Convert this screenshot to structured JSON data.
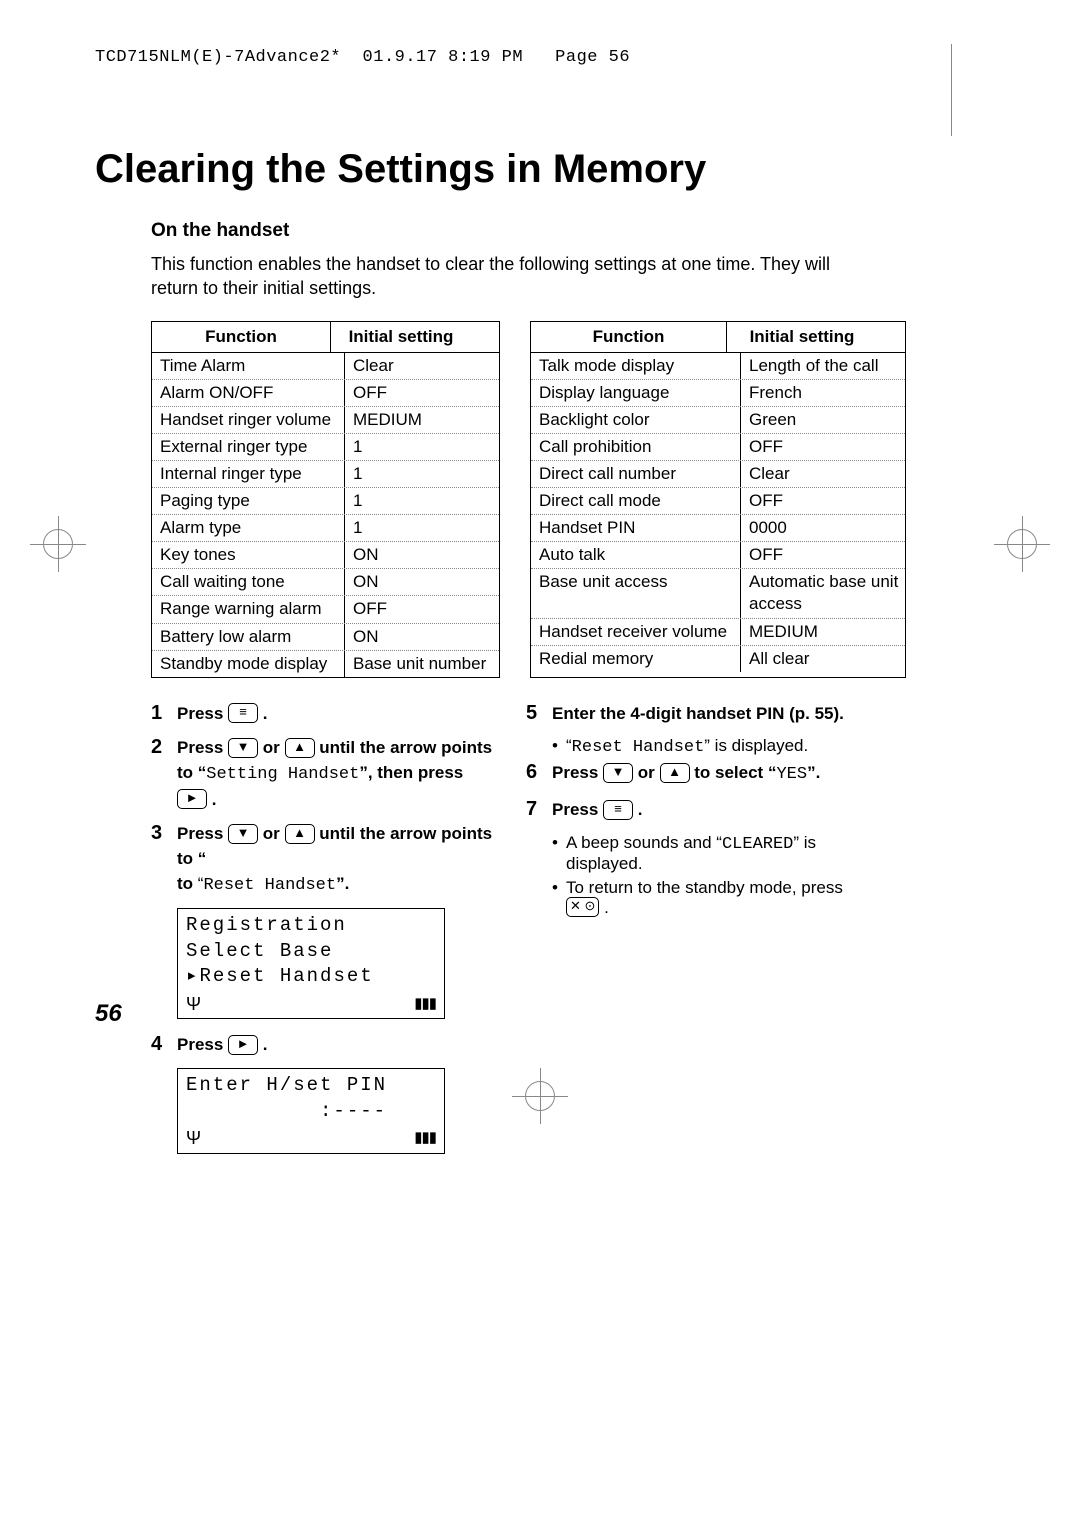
{
  "header_line": "TCD715NLM(E)-7Advance2*  01.9.17 8:19 PM   Page 56",
  "title": "Clearing the Settings in Memory",
  "section": "On the handset",
  "intro": "This function enables the handset to clear the following settings at one time. They will return to their initial settings.",
  "table_headers": {
    "func": "Function",
    "init": "Initial setting"
  },
  "tableA": [
    {
      "f": "Time Alarm",
      "v": "Clear"
    },
    {
      "f": "Alarm ON/OFF",
      "v": "OFF"
    },
    {
      "f": "Handset ringer volume",
      "v": "MEDIUM"
    },
    {
      "f": "External ringer type",
      "v": "1"
    },
    {
      "f": "Internal ringer type",
      "v": "1"
    },
    {
      "f": "Paging type",
      "v": "1"
    },
    {
      "f": "Alarm type",
      "v": "1"
    },
    {
      "f": "Key tones",
      "v": "ON"
    },
    {
      "f": "Call waiting tone",
      "v": "ON"
    },
    {
      "f": "Range warning alarm",
      "v": "OFF"
    },
    {
      "f": "Battery low alarm",
      "v": "ON"
    },
    {
      "f": "Standby mode display",
      "v": "Base unit number"
    }
  ],
  "tableB": [
    {
      "f": "Talk mode display",
      "v": "Length of the call"
    },
    {
      "f": "Display language",
      "v": "French"
    },
    {
      "f": "Backlight color",
      "v": "Green"
    },
    {
      "f": "Call prohibition",
      "v": "OFF"
    },
    {
      "f": "Direct call number",
      "v": "Clear"
    },
    {
      "f": "Direct call mode",
      "v": "OFF"
    },
    {
      "f": "Handset PIN",
      "v": "0000"
    },
    {
      "f": "Auto talk",
      "v": "OFF"
    },
    {
      "f": "Base unit access",
      "v": "Automatic base unit access"
    },
    {
      "f": "Handset receiver volume",
      "v": "MEDIUM"
    },
    {
      "f": "Redial memory",
      "v": "All clear"
    }
  ],
  "keys": {
    "menu": "≡",
    "down": "▼",
    "up": "▲",
    "right": "►",
    "end": "✕ ⊙"
  },
  "steps_left": {
    "1": {
      "pre": "Press ",
      "post": " ."
    },
    "2": {
      "pre": "Press ",
      "mid": " or ",
      "tail": " until the arrow points to “",
      "target": "Setting Handset",
      "after": "”, then press",
      "end": " ."
    },
    "3": {
      "pre": "Press ",
      "mid": " or ",
      "tail": " until the arrow points to “",
      "target": "Reset Handset",
      "after": "”."
    },
    "lcd1": {
      "l1": "Registration",
      "l2": "Select Base",
      "l3": "▸Reset Handset"
    },
    "4": {
      "pre": "Press ",
      "post": " ."
    },
    "lcd2": {
      "l1": "Enter H/set PIN",
      "l2": "          :----"
    }
  },
  "steps_right": {
    "5": {
      "text": "Enter the 4-digit handset PIN (p. 55).",
      "b1a": "“",
      "b1m": "Reset Handset",
      "b1b": "” is displayed."
    },
    "6": {
      "pre": "Press ",
      "mid": " or ",
      "tail": " to select “",
      "target": "YES",
      "after": "”."
    },
    "7": {
      "pre": "Press ",
      "post": " .",
      "b1a": "A beep sounds and “",
      "b1m": "CLEARED",
      "b1b": "” is displayed.",
      "b2a": "To return to the standby mode, press ",
      "b2b": " ."
    }
  },
  "page_number": "56",
  "lcd_icons": {
    "antenna": "Ψ",
    "battery": "▮▮▮"
  }
}
